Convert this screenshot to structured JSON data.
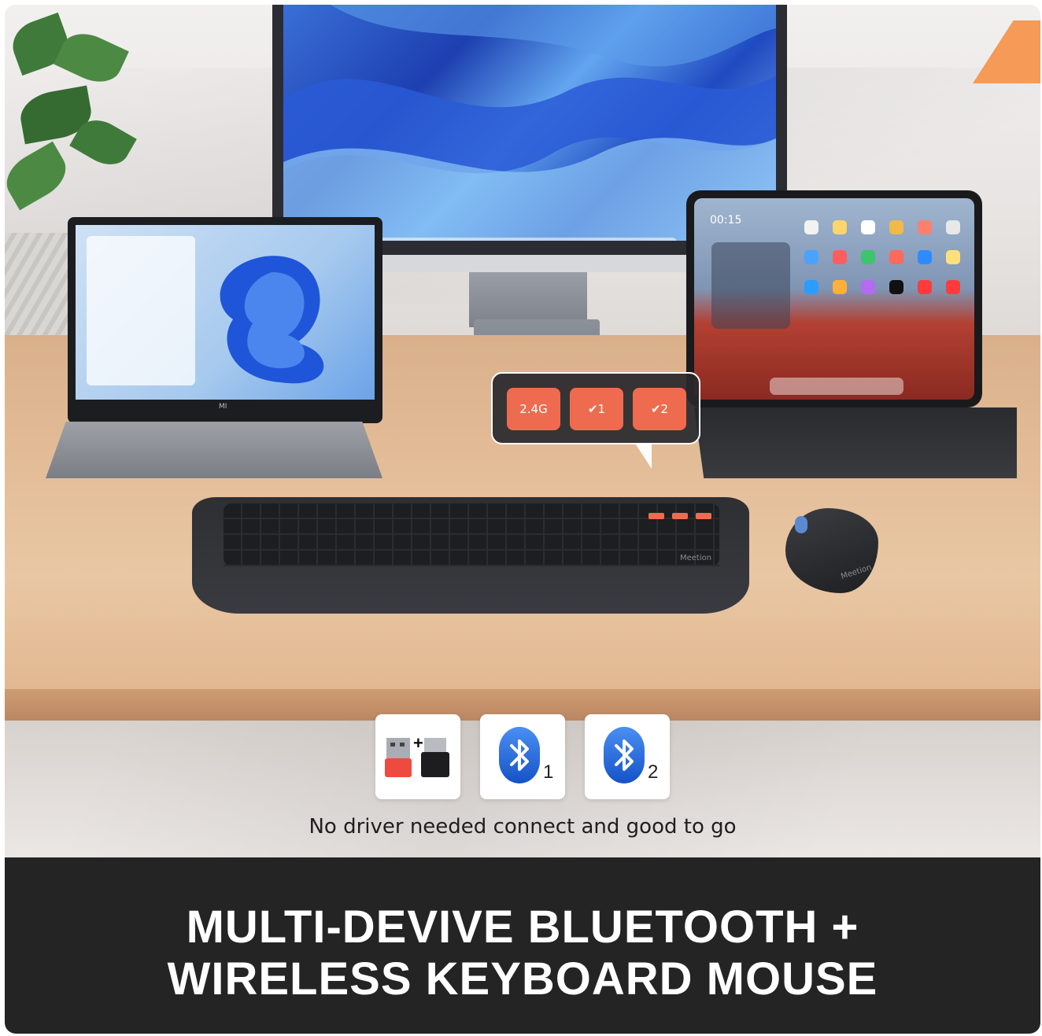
{
  "scene": {
    "laptop_brand": "MI",
    "tablet_clock": "00:15",
    "keyboard_brand": "Meetion",
    "mouse_brand": "Meetion"
  },
  "mode_switch": {
    "keys": [
      {
        "label": "2.4G"
      },
      {
        "label": "✔1",
        "icon": "bluetooth-icon"
      },
      {
        "label": "✔2",
        "icon": "bluetooth-icon"
      }
    ],
    "key_color": "#ef6b4f"
  },
  "connections": [
    {
      "icon": "usb-receiver-icon",
      "extra": "+"
    },
    {
      "icon": "bluetooth-icon",
      "number": "1"
    },
    {
      "icon": "bluetooth-icon",
      "number": "2"
    }
  ],
  "tagline": "No driver needed connect and good to go",
  "headline": {
    "line1": "MULTI-DEVIVE BLUETOOTH +",
    "line2": "WIRELESS KEYBOARD MOUSE"
  },
  "colors": {
    "footer_bg": "#242424",
    "accent": "#ef6b4f",
    "bluetooth_blue": "#1a63d6"
  }
}
